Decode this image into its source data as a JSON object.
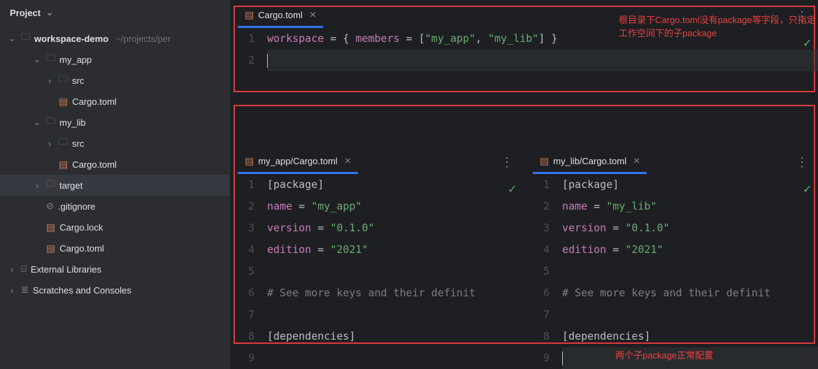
{
  "sidebar": {
    "title": "Project",
    "root": {
      "label": "workspace-demo",
      "hint": "~/projects/per"
    },
    "items": [
      {
        "indent": 2,
        "arrow": "v",
        "icon": "folder",
        "label": "my_app"
      },
      {
        "indent": 3,
        "arrow": ">",
        "icon": "folder-src",
        "label": "src"
      },
      {
        "indent": 3,
        "arrow": "",
        "icon": "toml",
        "label": "Cargo.toml"
      },
      {
        "indent": 2,
        "arrow": "v",
        "icon": "folder",
        "label": "my_lib"
      },
      {
        "indent": 3,
        "arrow": ">",
        "icon": "folder-src",
        "label": "src"
      },
      {
        "indent": 3,
        "arrow": "",
        "icon": "toml",
        "label": "Cargo.toml"
      },
      {
        "indent": 2,
        "arrow": ">",
        "icon": "folder-tgt",
        "label": "target",
        "sel": true
      },
      {
        "indent": 2,
        "arrow": "",
        "icon": "ign",
        "label": ".gitignore"
      },
      {
        "indent": 2,
        "arrow": "",
        "icon": "lock",
        "label": "Cargo.lock"
      },
      {
        "indent": 2,
        "arrow": "",
        "icon": "toml",
        "label": "Cargo.toml"
      }
    ],
    "ext_lib": "External Libraries",
    "scratches": "Scratches and Consoles"
  },
  "annot": {
    "top": "根目录下Cargo.toml没有package等字段，只指定工作空间下的子package",
    "bot": "两个子package正常配置"
  },
  "editors": {
    "root": {
      "tab": "Cargo.toml",
      "lines": [
        {
          "n": 1,
          "tokens": [
            {
              "t": "key",
              "v": "workspace"
            },
            {
              "t": "op",
              "v": " = "
            },
            {
              "t": "br",
              "v": "{ "
            },
            {
              "t": "key",
              "v": "members"
            },
            {
              "t": "op",
              "v": " = "
            },
            {
              "t": "br",
              "v": "["
            },
            {
              "t": "str",
              "v": "\"my_app\""
            },
            {
              "t": "op",
              "v": ", "
            },
            {
              "t": "str",
              "v": "\"my_lib\""
            },
            {
              "t": "br",
              "v": "] }"
            }
          ]
        },
        {
          "n": 2,
          "cur": true,
          "tokens": []
        }
      ]
    },
    "app": {
      "tab": "my_app/Cargo.toml",
      "lines": [
        {
          "n": 1,
          "tokens": [
            {
              "t": "sec",
              "v": "[package]"
            }
          ]
        },
        {
          "n": 2,
          "tokens": [
            {
              "t": "key",
              "v": "name"
            },
            {
              "t": "op",
              "v": " = "
            },
            {
              "t": "str",
              "v": "\"my_app\""
            }
          ]
        },
        {
          "n": 3,
          "tokens": [
            {
              "t": "key",
              "v": "version"
            },
            {
              "t": "op",
              "v": " = "
            },
            {
              "t": "str",
              "v": "\"0.1.0\""
            }
          ]
        },
        {
          "n": 4,
          "tokens": [
            {
              "t": "key",
              "v": "edition"
            },
            {
              "t": "op",
              "v": " = "
            },
            {
              "t": "str",
              "v": "\"2021\""
            }
          ]
        },
        {
          "n": 5,
          "tokens": []
        },
        {
          "n": 6,
          "tokens": [
            {
              "t": "cmt",
              "v": "# See more keys and their definit"
            }
          ]
        },
        {
          "n": 7,
          "tokens": []
        },
        {
          "n": 8,
          "tokens": [
            {
              "t": "sec",
              "v": "[dependencies]"
            }
          ]
        },
        {
          "n": 9,
          "tokens": []
        }
      ]
    },
    "lib": {
      "tab": "my_lib/Cargo.toml",
      "lines": [
        {
          "n": 1,
          "tokens": [
            {
              "t": "sec",
              "v": "[package]"
            }
          ]
        },
        {
          "n": 2,
          "tokens": [
            {
              "t": "key",
              "v": "name"
            },
            {
              "t": "op",
              "v": " = "
            },
            {
              "t": "str",
              "v": "\"my_lib\""
            }
          ]
        },
        {
          "n": 3,
          "tokens": [
            {
              "t": "key",
              "v": "version"
            },
            {
              "t": "op",
              "v": " = "
            },
            {
              "t": "str",
              "v": "\"0.1.0\""
            }
          ]
        },
        {
          "n": 4,
          "tokens": [
            {
              "t": "key",
              "v": "edition"
            },
            {
              "t": "op",
              "v": " = "
            },
            {
              "t": "str",
              "v": "\"2021\""
            }
          ]
        },
        {
          "n": 5,
          "tokens": []
        },
        {
          "n": 6,
          "tokens": [
            {
              "t": "cmt",
              "v": "# See more keys and their definit"
            }
          ]
        },
        {
          "n": 7,
          "tokens": []
        },
        {
          "n": 8,
          "tokens": [
            {
              "t": "sec",
              "v": "[dependencies]"
            }
          ]
        },
        {
          "n": 9,
          "cur": true,
          "tokens": []
        }
      ]
    }
  }
}
